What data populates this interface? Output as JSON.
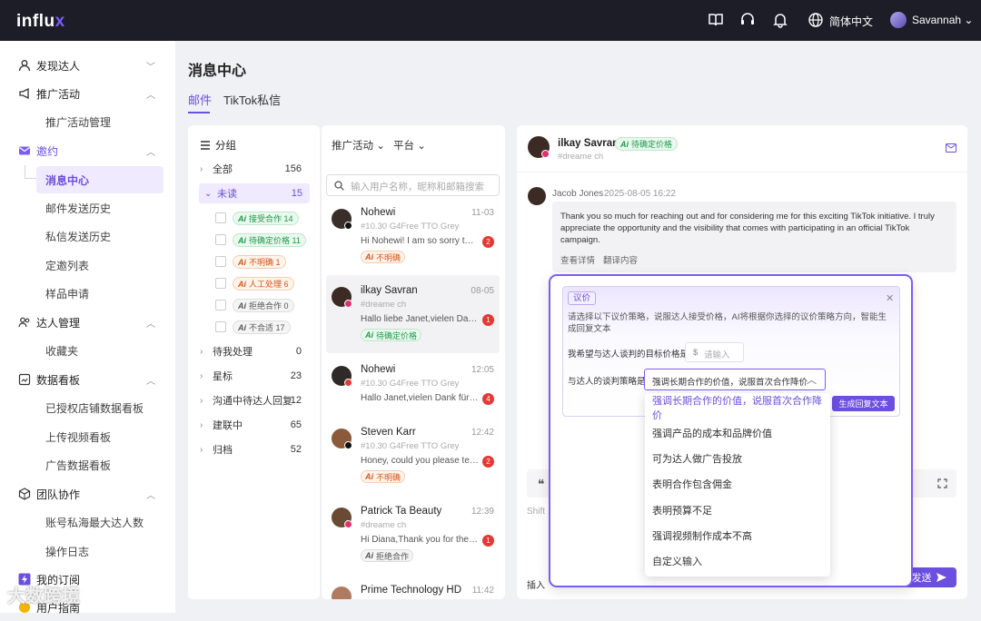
{
  "app": {
    "logo_prefix": "influ",
    "logo_suffix": "x"
  },
  "topbar": {
    "language": "简体中文",
    "user_name": "Savannah"
  },
  "sidebar": {
    "discover": "发现达人",
    "campaigns": "推广活动",
    "campaign_manage": "推广活动管理",
    "invite": "邀约",
    "message_center": "消息中心",
    "email_history": "邮件发送历史",
    "dm_history": "私信发送历史",
    "scheduled_list": "定邀列表",
    "sample_apply": "样品申请",
    "creator_manage": "达人管理",
    "favorites": "收藏夹",
    "dashboards": "数据看板",
    "shop_dashboard": "已授权店铺数据看板",
    "video_dashboard": "上传视频看板",
    "ad_dashboard": "广告数据看板",
    "team": "团队协作",
    "account_creator": "账号私海最大达人数",
    "operation_log": "操作日志",
    "subscription": "我的订阅",
    "user_guide": "用户指南"
  },
  "page": {
    "title": "消息中心",
    "tabs": [
      "邮件",
      "TikTok私信"
    ]
  },
  "groups": {
    "header": "分组",
    "items": [
      {
        "label": "全部",
        "count": "156"
      },
      {
        "label": "未读",
        "count": "15"
      }
    ],
    "tags": [
      {
        "label": "接受合作",
        "count": "14"
      },
      {
        "label": "待确定价格",
        "count": "11"
      },
      {
        "label": "不明确",
        "count": "1"
      },
      {
        "label": "人工处理",
        "count": "6"
      },
      {
        "label": "拒绝合作",
        "count": "0"
      },
      {
        "label": "不合适",
        "count": "17"
      }
    ],
    "others": [
      {
        "label": "待我处理",
        "count": "0"
      },
      {
        "label": "星标",
        "count": "23"
      },
      {
        "label": "沟通中待达人回复",
        "count": "12"
      },
      {
        "label": "建联中",
        "count": "65"
      },
      {
        "label": "归档",
        "count": "52"
      }
    ]
  },
  "messages": {
    "filter_campaign": "推广活动",
    "filter_platform": "平台",
    "search_placeholder": "输入用户名称，昵称和邮箱搜索",
    "list": [
      {
        "name": "Nohewi",
        "time": "11-03",
        "sub": "#10.30 G4Free TTO Grey",
        "preview": "Hi Nohewi! I am so sorry to hear that",
        "unread": "2",
        "tag": "不明确"
      },
      {
        "name": "ilkay Savran",
        "time": "08-05",
        "sub": "#dreame ch",
        "preview": "Hallo liebe Janet,vielen Dank für die Nachricht",
        "unread": "1",
        "tag": "待确定价格"
      },
      {
        "name": "Nohewi",
        "time": "12:05",
        "sub": "#10.30 G4Free TTO Grey",
        "preview": "Hallo Janet,vielen Dank für die Einladung",
        "unread": "4",
        "tag": ""
      },
      {
        "name": "Steven Karr",
        "time": "12:42",
        "sub": "#10.30 G4Free TTO Grey",
        "preview": "Honey, could you please tell me more",
        "unread": "2",
        "tag": "不明确"
      },
      {
        "name": "Patrick Ta Beauty",
        "time": "12:39",
        "sub": "#dreame ch",
        "preview": "Hi Diana,Thank you for the offer",
        "unread": "1",
        "tag": "拒绝合作"
      },
      {
        "name": "Prime Technology HD",
        "time": "11:42",
        "sub": "",
        "preview": "",
        "unread": "",
        "tag": ""
      }
    ]
  },
  "conversation": {
    "name": "ilkay Savran",
    "status": "待确定价格",
    "campaign": "#dreame ch",
    "sender": "Jacob Jones",
    "sent_at": "2025-08-05 16:22",
    "body": "Thank you so much for reaching out and for considering me for this exciting TikTok initiative. I truly appreciate the opportunity and the visibility that comes with participating in an official TikTok campaign.",
    "view_detail": "查看详情",
    "translate": "翻译内容",
    "shift_hint": "Shift",
    "insert_label": "插入",
    "send": "发送"
  },
  "negotiation": {
    "tag": "议价",
    "desc": "请选择以下议价策略，说服达人接受价格，AI将根据你选择的议价策略方向，智能生成回复文本",
    "target_price_label": "我希望与达人谈判的目标价格是",
    "currency": "$",
    "price_placeholder": "请输入",
    "strategy_label": "与达人的谈判策略是",
    "strategy_value": "强调长期合作的价值，说服首次合作降价",
    "generate": "生成回复文本",
    "options": [
      "强调长期合作的价值，说服首次合作降价",
      "强调产品的成本和品牌价值",
      "可为达人做广告投放",
      "表明合作包含佣金",
      "表明预算不足",
      "强调视频制作成本不高",
      "自定义输入"
    ]
  },
  "watermark": "大数跨境",
  "colors": {
    "accent": "#6b4fe0",
    "topbar": "#1c1d27"
  }
}
